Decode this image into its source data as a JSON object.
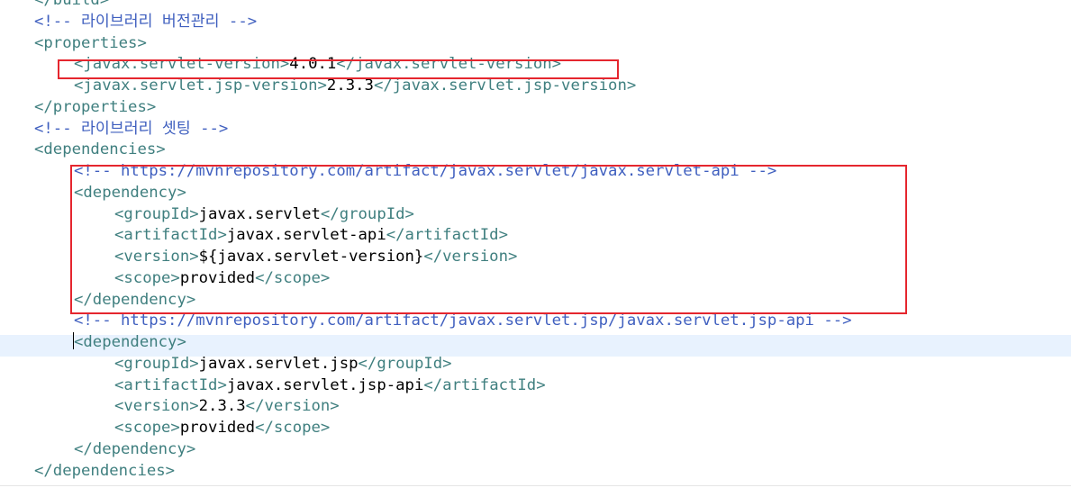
{
  "lines": [
    {
      "parts": [
        {
          "c": "tag",
          "t": "</build>"
        }
      ]
    },
    {
      "parts": [
        {
          "c": "comment",
          "t": "<!-- 라이브러리 버전관리 -->"
        }
      ]
    },
    {
      "parts": [
        {
          "c": "tag",
          "t": "<properties>"
        }
      ]
    },
    {
      "parts": [
        {
          "c": "tag",
          "t": "<javax.servlet-version>"
        },
        {
          "c": "text",
          "t": "4.0.1"
        },
        {
          "c": "tag",
          "t": "</javax.servlet-version>"
        }
      ]
    },
    {
      "parts": [
        {
          "c": "tag",
          "t": "<javax.servlet.jsp-version>"
        },
        {
          "c": "text",
          "t": "2.3.3"
        },
        {
          "c": "tag",
          "t": "</javax.servlet.jsp-version>"
        }
      ]
    },
    {
      "parts": [
        {
          "c": "tag",
          "t": "</properties>"
        }
      ]
    },
    {
      "parts": [
        {
          "c": "comment",
          "t": "<!-- 라이브러리 셋팅 -->"
        }
      ]
    },
    {
      "parts": [
        {
          "c": "tag",
          "t": "<dependencies>"
        }
      ]
    },
    {
      "parts": [
        {
          "c": "comment",
          "t": "<!-- https://mvnrepository.com/artifact/javax.servlet/javax.servlet-api -->"
        }
      ]
    },
    {
      "parts": [
        {
          "c": "tag",
          "t": "<dependency>"
        }
      ]
    },
    {
      "parts": [
        {
          "c": "tag",
          "t": "<groupId>"
        },
        {
          "c": "text",
          "t": "javax.servlet"
        },
        {
          "c": "tag",
          "t": "</groupId>"
        }
      ]
    },
    {
      "parts": [
        {
          "c": "tag",
          "t": "<artifactId>"
        },
        {
          "c": "text",
          "t": "javax.servlet-api"
        },
        {
          "c": "tag",
          "t": "</artifactId>"
        }
      ]
    },
    {
      "parts": [
        {
          "c": "tag",
          "t": "<version>"
        },
        {
          "c": "text",
          "t": "${javax.servlet-version}"
        },
        {
          "c": "tag",
          "t": "</version>"
        }
      ]
    },
    {
      "parts": [
        {
          "c": "tag",
          "t": "<scope>"
        },
        {
          "c": "text",
          "t": "provided"
        },
        {
          "c": "tag",
          "t": "</scope>"
        }
      ]
    },
    {
      "parts": [
        {
          "c": "tag",
          "t": "</dependency>"
        }
      ]
    },
    {
      "parts": [
        {
          "c": "comment",
          "t": "<!-- https://mvnrepository.com/artifact/javax.servlet.jsp/javax.servlet.jsp-api -->"
        }
      ]
    },
    {
      "parts": [
        {
          "c": "tag",
          "t": "<dependency>"
        }
      ],
      "cursor": true
    },
    {
      "parts": [
        {
          "c": "tag",
          "t": "<groupId>"
        },
        {
          "c": "text",
          "t": "javax.servlet.jsp"
        },
        {
          "c": "tag",
          "t": "</groupId>"
        }
      ]
    },
    {
      "parts": [
        {
          "c": "tag",
          "t": "<artifactId>"
        },
        {
          "c": "text",
          "t": "javax.servlet.jsp-api"
        },
        {
          "c": "tag",
          "t": "</artifactId>"
        }
      ]
    },
    {
      "parts": [
        {
          "c": "tag",
          "t": "<version>"
        },
        {
          "c": "text",
          "t": "2.3.3"
        },
        {
          "c": "tag",
          "t": "</version>"
        }
      ]
    },
    {
      "parts": [
        {
          "c": "tag",
          "t": "<scope>"
        },
        {
          "c": "text",
          "t": "provided"
        },
        {
          "c": "tag",
          "t": "</scope>"
        }
      ]
    },
    {
      "parts": [
        {
          "c": "tag",
          "t": "</dependency>"
        }
      ]
    },
    {
      "parts": [
        {
          "c": "tag",
          "t": "</dependencies>"
        }
      ]
    }
  ],
  "colors": {
    "tag": "#3f7f7f",
    "comment": "#3f5fbf",
    "text": "#000000",
    "highlight": "#e5262e",
    "current_line": "#e8f2fe"
  }
}
